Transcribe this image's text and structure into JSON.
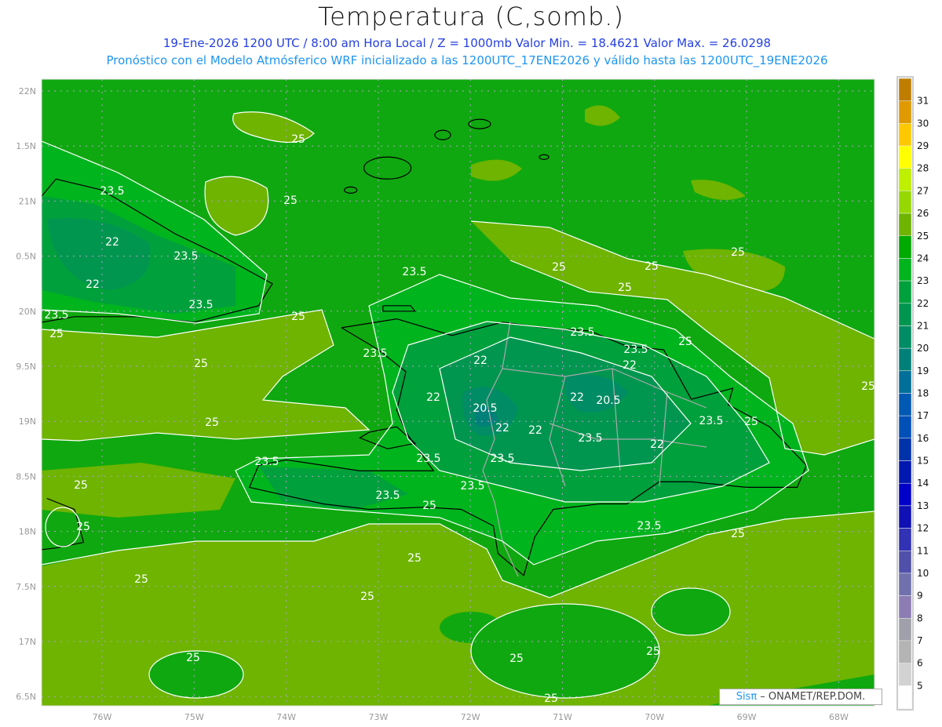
{
  "header": {
    "title": "Temperatura (C,somb.)",
    "subtitle_1": "19-Ene-2026  1200 UTC / 8:00 am Hora Local / Z = 1000mb    Valor Min. = 18.4621   Valor Max. = 26.0298",
    "subtitle_2": "Pronóstico con el Modelo Atmósferico WRF inicializado a las 1200UTC_17ENE2026 y válido hasta las  1200UTC_19ENE2026"
  },
  "axes": {
    "lon_labels": [
      "76W",
      "75W",
      "74W",
      "73W",
      "72W",
      "71W",
      "70W",
      "69W",
      "68W"
    ],
    "lat_labels": [
      "22N",
      "1.5N",
      "21N",
      "0.5N",
      "20N",
      "9.5N",
      "19N",
      "8.5N",
      "18N",
      "7.5N",
      "17N",
      "6.5N"
    ]
  },
  "colorbar": {
    "labels": [
      "31",
      "30",
      "29",
      "28",
      "27",
      "26",
      "25",
      "24",
      "23",
      "22",
      "21",
      "20",
      "19",
      "18",
      "17",
      "16",
      "15",
      "14",
      "13",
      "12",
      "11",
      "10",
      "9",
      "8",
      "7",
      "6",
      "5"
    ],
    "colors": [
      "#c07e00",
      "#e09a00",
      "#ffc800",
      "#ffff00",
      "#bef000",
      "#96d800",
      "#6eb400",
      "#00aa00",
      "#00b41e",
      "#00a03c",
      "#009650",
      "#008c64",
      "#008078",
      "#00709a",
      "#005ab4",
      "#0050b8",
      "#0032aa",
      "#0018b0",
      "#0000c8",
      "#1010b4",
      "#3232b4",
      "#5050aa",
      "#7070ac",
      "#8c7cb4",
      "#a0a0aa",
      "#b4b4b4",
      "#d2d2d2",
      "#ffffff"
    ]
  },
  "contour_labels": [
    "25",
    "25",
    "23.5",
    "22",
    "23.5",
    "22",
    "23.5",
    "23.5",
    "25",
    "25",
    "25",
    "25",
    "23.5",
    "25",
    "25",
    "25",
    "25",
    "25",
    "25",
    "23.5",
    "22",
    "23.5",
    "23.5",
    "22",
    "22",
    "20.5",
    "22",
    "20.5",
    "22",
    "22",
    "23.5",
    "22",
    "23.5",
    "25",
    "23.5",
    "23.5",
    "23.5",
    "23.5",
    "23.5",
    "25",
    "25",
    "25",
    "23.5",
    "25",
    "25",
    "25",
    "25",
    "25",
    "25",
    "25",
    "25"
  ],
  "credit": {
    "logo": "Sisπ",
    "text": " – ONAMET/REP.DOM."
  }
}
